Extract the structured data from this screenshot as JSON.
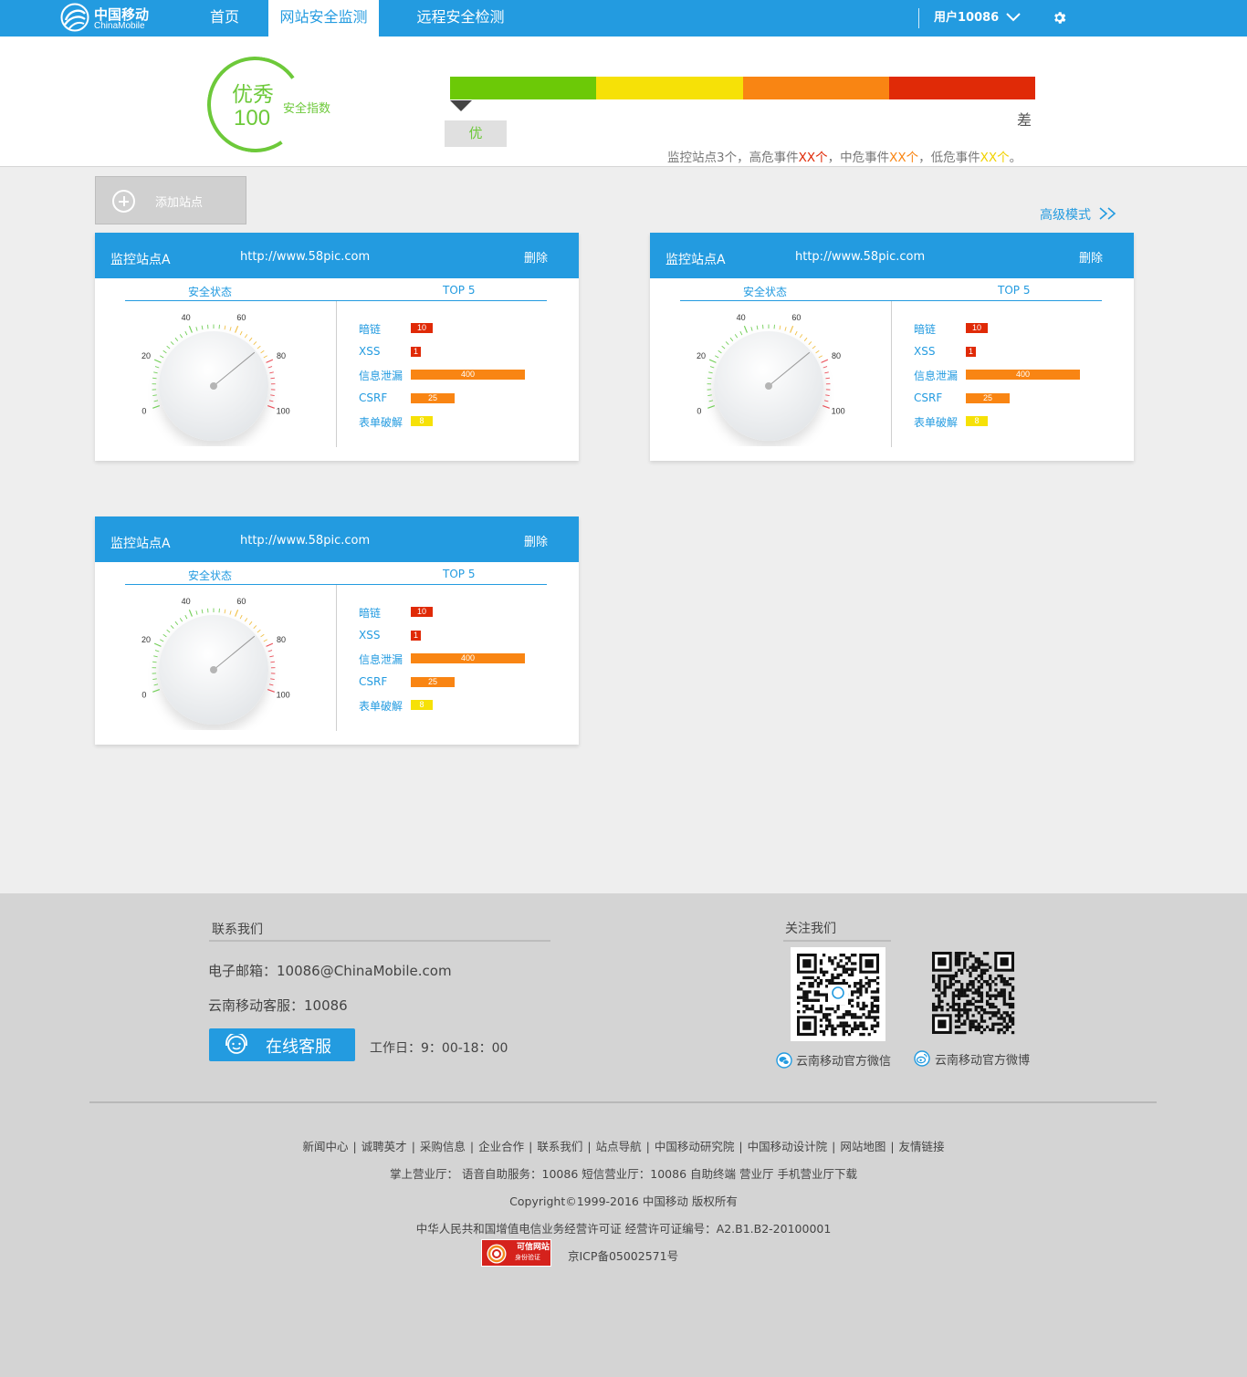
{
  "nav": {
    "logo_cn": "中国移动",
    "logo_en": "ChinaMobile",
    "items": [
      {
        "label": "首页"
      },
      {
        "label": "网站安全监测"
      },
      {
        "label": "远程安全检测"
      }
    ],
    "active_index": 1,
    "user": "用户10086"
  },
  "score": {
    "grade": "优秀",
    "value": "100",
    "label": "安全指数",
    "levels_colors": [
      "#6cc907",
      "#f6e107",
      "#f98513",
      "#e02a07"
    ],
    "pointer_level": "优",
    "worst_level": "差",
    "summary": {
      "prefix": "监控站点3个，高危事件",
      "high": "XX个",
      "mid_text": "，中危事件",
      "mid": "XX个",
      "low_text": "，低危事件",
      "low": "XX个",
      "suffix": "。"
    }
  },
  "toolbar": {
    "add_label": "添加站点",
    "advanced_label": "高级模式"
  },
  "cards": [
    {
      "title": "监控站点A",
      "url": "http://www.58pic.com",
      "delete_label": "删除",
      "status_title": "安全状态",
      "top_title": "TOP 5",
      "gauge": {
        "ticks": [
          "0",
          "20",
          "40",
          "60",
          "80",
          "100"
        ],
        "value": 73
      },
      "top5": [
        {
          "name": "暗链",
          "count": "10",
          "color": "#e02a07"
        },
        {
          "name": "XSS",
          "count": "1",
          "color": "#e02a07"
        },
        {
          "name": "信息泄漏",
          "count": "400",
          "color": "#f98513"
        },
        {
          "name": "CSRF",
          "count": "25",
          "color": "#f98513"
        },
        {
          "name": "表单破解",
          "count": "8",
          "color": "#f6e107"
        }
      ]
    },
    {
      "title": "监控站点A",
      "url": "http://www.58pic.com",
      "delete_label": "删除",
      "status_title": "安全状态",
      "top_title": "TOP 5",
      "gauge": {
        "ticks": [
          "0",
          "20",
          "40",
          "60",
          "80",
          "100"
        ],
        "value": 73
      },
      "top5": [
        {
          "name": "暗链",
          "count": "10",
          "color": "#e02a07"
        },
        {
          "name": "XSS",
          "count": "1",
          "color": "#e02a07"
        },
        {
          "name": "信息泄漏",
          "count": "400",
          "color": "#f98513"
        },
        {
          "name": "CSRF",
          "count": "25",
          "color": "#f98513"
        },
        {
          "name": "表单破解",
          "count": "8",
          "color": "#f6e107"
        }
      ]
    },
    {
      "title": "监控站点A",
      "url": "http://www.58pic.com",
      "delete_label": "删除",
      "status_title": "安全状态",
      "top_title": "TOP 5",
      "gauge": {
        "ticks": [
          "0",
          "20",
          "40",
          "60",
          "80",
          "100"
        ],
        "value": 73
      },
      "top5": [
        {
          "name": "暗链",
          "count": "10",
          "color": "#e02a07"
        },
        {
          "name": "XSS",
          "count": "1",
          "color": "#e02a07"
        },
        {
          "name": "信息泄漏",
          "count": "400",
          "color": "#f98513"
        },
        {
          "name": "CSRF",
          "count": "25",
          "color": "#f98513"
        },
        {
          "name": "表单破解",
          "count": "8",
          "color": "#f6e107"
        }
      ]
    }
  ],
  "footer": {
    "contact_title": "联系我们",
    "email": "电子邮箱：10086@ChinaMobile.com",
    "phone": "云南移动客服：10086",
    "cs_button": "在线客服",
    "hours": "工作日：9：00-18：00",
    "follow_title": "关注我们",
    "wechat_label": "云南移动官方微信",
    "weibo_label": "云南移动官方微博",
    "links": [
      "新闻中心",
      "诚聘英才",
      "采购信息",
      "企业合作",
      "联系我们",
      "站点导航",
      "中国移动研究院",
      "中国移动设计院",
      "网站地图",
      "友情链接"
    ],
    "services": "掌上营业厅： 语音自助服务：10086 短信营业厅：10086 自助终端 营业厅 手机营业厅下载",
    "copyright": "Copyright©1999-2016  中国移动  版权所有",
    "license": "中华人民共和国增值电信业务经营许可证  经营许可证编号：A2.B1.B2-20100001",
    "badge_title": "可信网站",
    "badge_sub": "身份验证",
    "icp": "京ICP备05002571号"
  }
}
